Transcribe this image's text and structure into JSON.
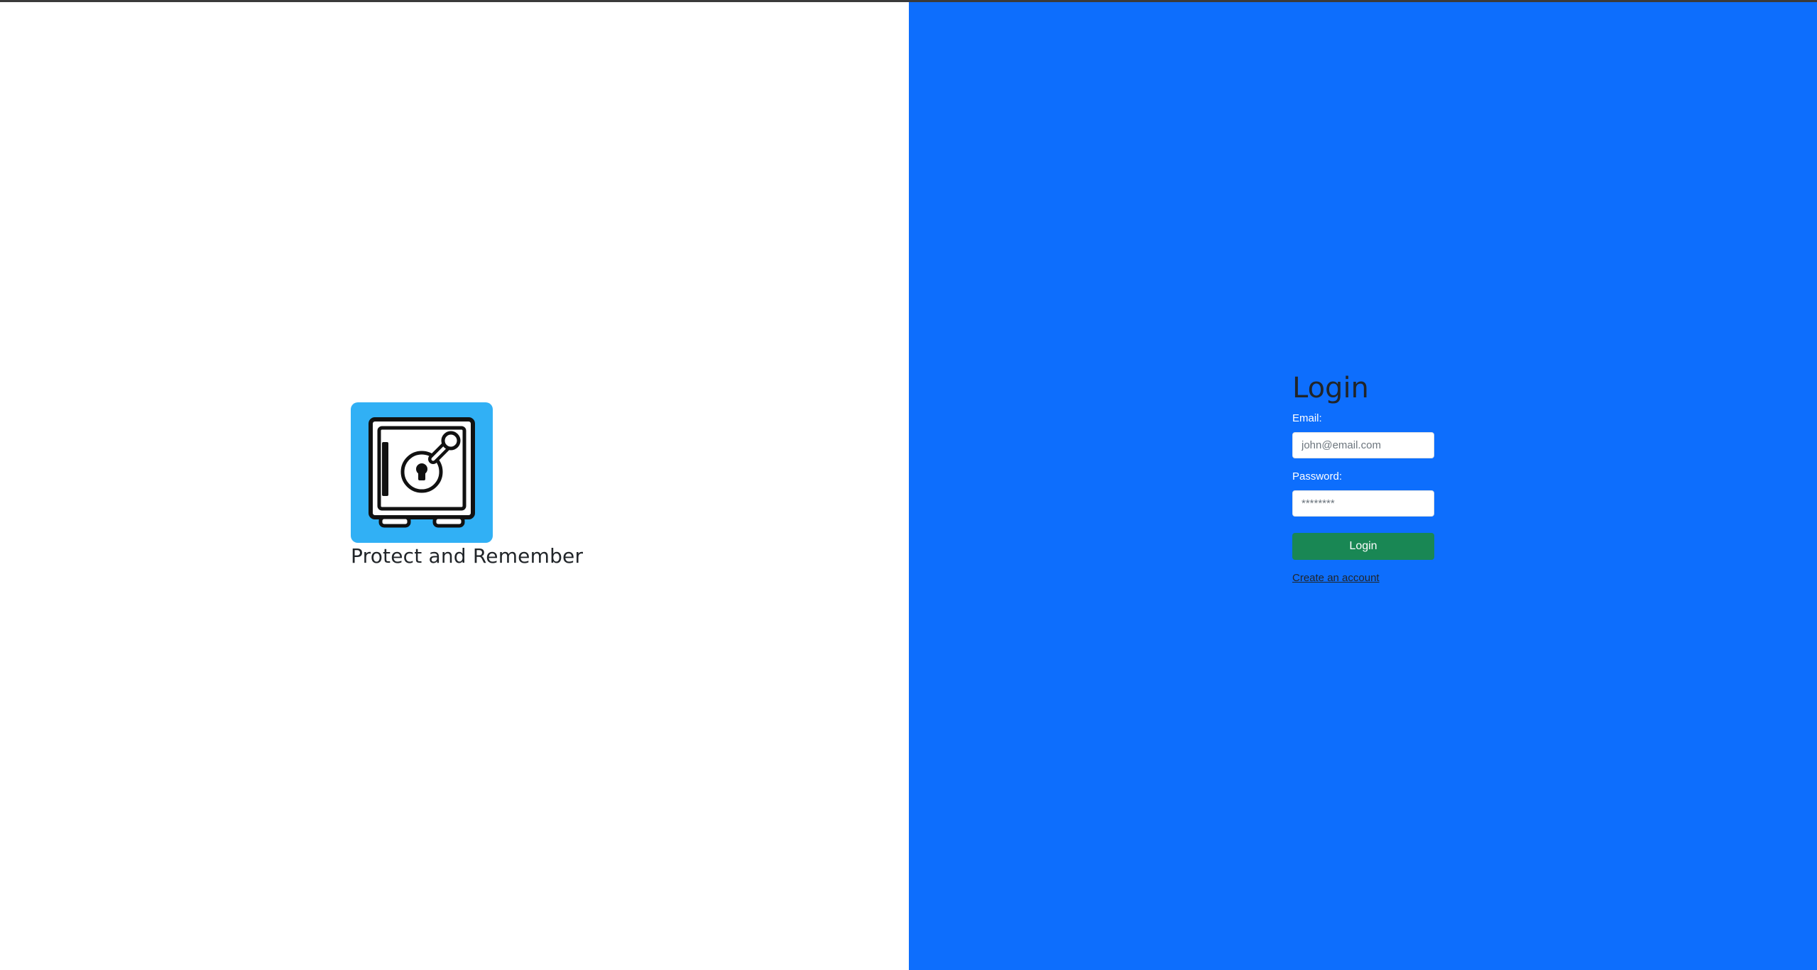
{
  "colors": {
    "left_background": "#ffffff",
    "right_background": "#0d6efd",
    "logo_background": "#31b0f5",
    "login_button": "#198754",
    "text_dark": "#212529"
  },
  "brand": {
    "logo_icon": "safe-icon",
    "tagline": "Protect and Remember"
  },
  "login": {
    "title": "Login",
    "email_label": "Email:",
    "email_placeholder": "john@email.com",
    "email_value": "",
    "password_label": "Password:",
    "password_placeholder": "********",
    "password_value": "",
    "submit_label": "Login",
    "create_account_label": "Create an account"
  }
}
